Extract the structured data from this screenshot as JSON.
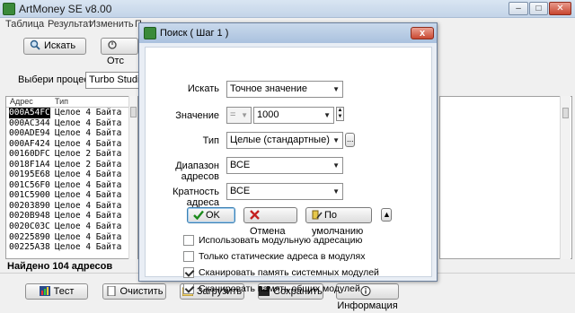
{
  "window": {
    "title": "ArtMoney SE v8.00",
    "min": "–",
    "max": "□",
    "close": "✕"
  },
  "menu": [
    "Таблица",
    "Результат",
    "Изменить",
    "П",
    "И",
    "П"
  ],
  "toolbar": {
    "search": "Искать",
    "filter": "Отс"
  },
  "process": {
    "label": "Выбери процесс",
    "value": "Turbo Studio 17"
  },
  "table": {
    "headers": [
      "Адрес",
      "Тип"
    ],
    "rows": [
      [
        "000A54FC",
        "Целое 4 Байта"
      ],
      [
        "000AC344",
        "Целое 4 Байта"
      ],
      [
        "000ADE94",
        "Целое 4 Байта"
      ],
      [
        "000AF424",
        "Целое 4 Байта"
      ],
      [
        "00160DFC",
        "Целое 2 Байта"
      ],
      [
        "0018F1A4",
        "Целое 2 Байта"
      ],
      [
        "00195E68",
        "Целое 4 Байта"
      ],
      [
        "001C56F0",
        "Целое 4 Байта"
      ],
      [
        "001C5900",
        "Целое 4 Байта"
      ],
      [
        "00203890",
        "Целое 4 Байта"
      ],
      [
        "0020B948",
        "Целое 4 Байта"
      ],
      [
        "0020C03C",
        "Целое 4 Байта"
      ],
      [
        "00225890",
        "Целое 4 Байта"
      ],
      [
        "00225A38",
        "Целое 4 Байта"
      ]
    ]
  },
  "status": "Найдено 104 адресов",
  "bottom_buttons": {
    "test": "Тест",
    "clear": "Очистить",
    "load": "Загрузить",
    "save": "Сохранить",
    "info": "Информация"
  },
  "dialog": {
    "title": "Поиск ( Шаг 1 )",
    "close": "x",
    "search_label": "Искать",
    "search_value": "Точное значение",
    "value_label": "Значение",
    "value_op": "=",
    "value_input": "1000",
    "type_label": "Тип",
    "type_value": "Целые (стандартные)",
    "type_more": "...",
    "range_label": "Диапазон адресов",
    "range_value": "ВСЕ",
    "align_label": "Кратность адреса",
    "align_value": "ВСЕ",
    "ok": "OK",
    "cancel": "Отмена",
    "default": "По умолчанию",
    "checkboxes": [
      {
        "label": "Использовать модульную адресацию",
        "checked": false
      },
      {
        "label": "Только статические адреса в модулях",
        "checked": false
      },
      {
        "label": "Сканировать память системных модулей",
        "checked": true
      },
      {
        "label": "Сканировать память общих модулей",
        "checked": true
      }
    ]
  }
}
